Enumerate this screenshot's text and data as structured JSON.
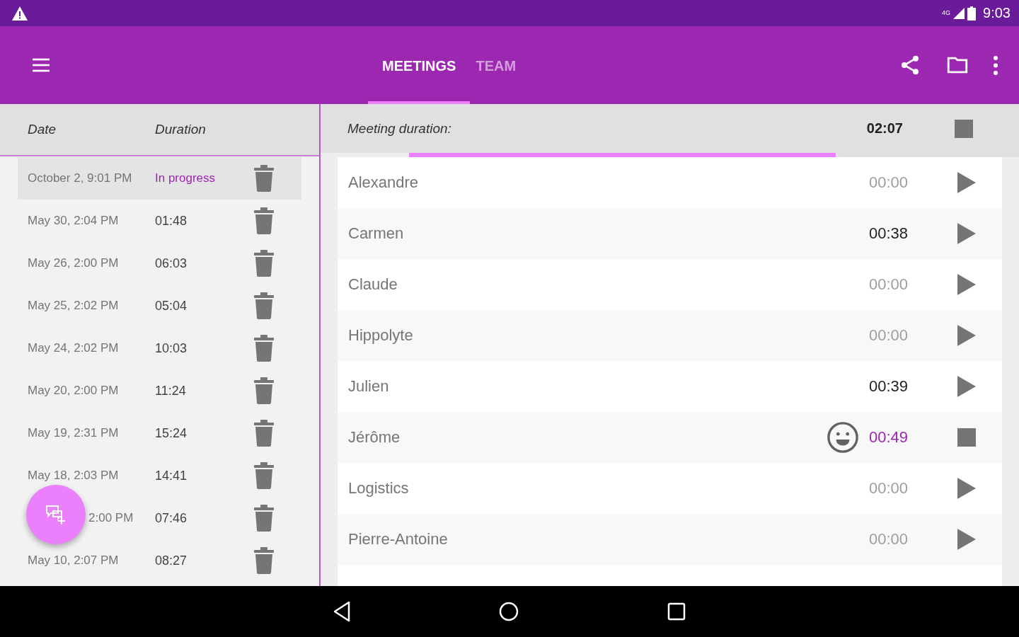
{
  "status_bar": {
    "time": "9:03",
    "network": "4G"
  },
  "app_bar": {
    "tabs": [
      {
        "label": "MEETINGS",
        "selected": true
      },
      {
        "label": "TEAM",
        "selected": false
      }
    ]
  },
  "meetings": {
    "columns": [
      "Date",
      "Duration"
    ],
    "rows": [
      {
        "date": "October 2, 9:01 PM",
        "duration": "In progress",
        "selected": true,
        "in_progress": true
      },
      {
        "date": "May 30, 2:04 PM",
        "duration": "01:48",
        "selected": false,
        "in_progress": false
      },
      {
        "date": "May 26, 2:00 PM",
        "duration": "06:03",
        "selected": false,
        "in_progress": false
      },
      {
        "date": "May 25, 2:02 PM",
        "duration": "05:04",
        "selected": false,
        "in_progress": false
      },
      {
        "date": "May 24, 2:02 PM",
        "duration": "10:03",
        "selected": false,
        "in_progress": false
      },
      {
        "date": "May 20, 2:00 PM",
        "duration": "11:24",
        "selected": false,
        "in_progress": false
      },
      {
        "date": "May 19, 2:31 PM",
        "duration": "15:24",
        "selected": false,
        "in_progress": false
      },
      {
        "date": "May 18, 2:03 PM",
        "duration": "14:41",
        "selected": false,
        "in_progress": false
      },
      {
        "date": "2:00 PM",
        "duration": "07:46",
        "selected": false,
        "in_progress": false
      },
      {
        "date": "May 10, 2:07 PM",
        "duration": "08:27",
        "selected": false,
        "in_progress": false
      }
    ]
  },
  "meeting": {
    "label": "Meeting duration:",
    "duration": "02:07",
    "progress": {
      "level": 0.7
    },
    "members": [
      {
        "name": "Alexandre",
        "time": "00:00",
        "kind": "idle"
      },
      {
        "name": "Carmen",
        "time": "00:38",
        "kind": "done"
      },
      {
        "name": "Claude",
        "time": "00:00",
        "kind": "idle"
      },
      {
        "name": "Hippolyte",
        "time": "00:00",
        "kind": "idle"
      },
      {
        "name": "Julien",
        "time": "00:39",
        "kind": "done"
      },
      {
        "name": "Jérôme",
        "time": "00:49",
        "kind": "running"
      },
      {
        "name": "Logistics",
        "time": "00:00",
        "kind": "idle"
      },
      {
        "name": "Pierre-Antoine",
        "time": "00:00",
        "kind": "idle"
      }
    ]
  }
}
